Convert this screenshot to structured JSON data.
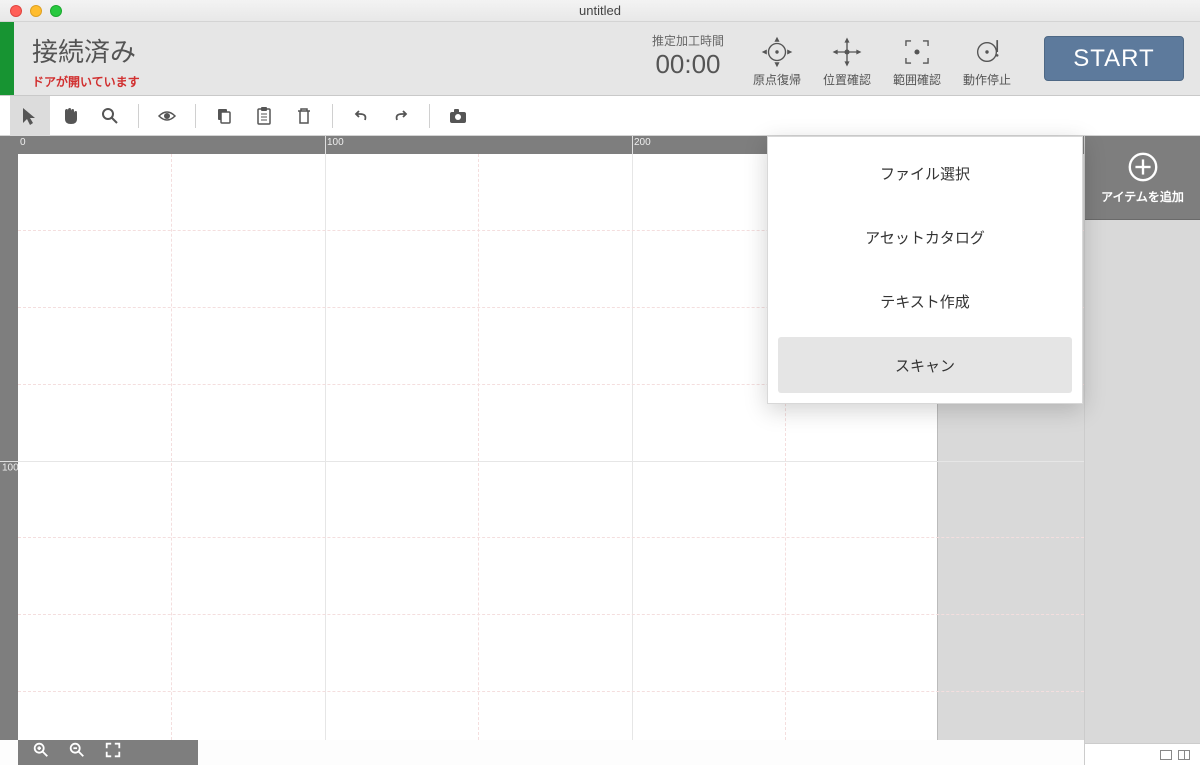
{
  "window": {
    "title": "untitled"
  },
  "header": {
    "status_main": "接続済み",
    "status_sub": "ドアが開いています",
    "time_label": "推定加工時間",
    "time_value": "00:00",
    "buttons": {
      "home": "原点復帰",
      "position": "位置確認",
      "range": "範囲確認",
      "stop": "動作停止"
    },
    "start": "START"
  },
  "ruler": {
    "h_labels": [
      "0",
      "100",
      "200"
    ],
    "v_labels": [
      "100"
    ]
  },
  "sidebar": {
    "add_item": "アイテムを追加"
  },
  "popup": {
    "items": [
      "ファイル選択",
      "アセットカタログ",
      "テキスト作成",
      "スキャン"
    ]
  }
}
